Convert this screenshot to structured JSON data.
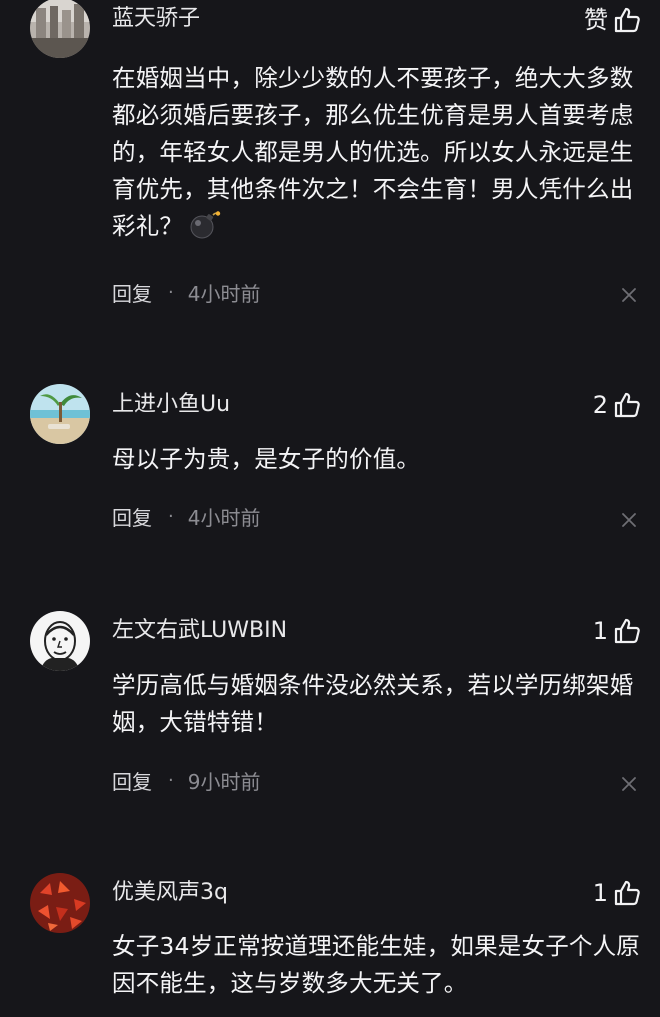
{
  "comments": [
    {
      "username": "蓝天骄子",
      "like_label": "赞",
      "content": "在婚姻当中，除少少数的人不要孩子，绝大大多数都必须婚后要孩子，那么优生优育是男人首要考虑的，年轻女人都是男人的优选。所以女人永远是生育优先，其他条件次之！不会生育！男人凭什么出彩礼？",
      "emoji": "bomb-icon",
      "reply_label": "回复",
      "separator": "·",
      "time": "4小时前"
    },
    {
      "username": "上进小鱼Uu",
      "like_label": "2",
      "content": "母以子为贵，是女子的价值。",
      "reply_label": "回复",
      "separator": "·",
      "time": "4小时前"
    },
    {
      "username": "左文右武LUWBIN",
      "like_label": "1",
      "content": "学历高低与婚姻条件没必然关系，若以学历绑架婚姻，大错特错！",
      "reply_label": "回复",
      "separator": "·",
      "time": "9小时前"
    },
    {
      "username": "优美风声3q",
      "like_label": "1",
      "content": "女子34岁正常按道理还能生娃，如果是女子个人原因不能生，这与岁数多大无关了。"
    }
  ],
  "icons": {
    "like": "thumbs-up-icon",
    "close": "close-icon",
    "emoji": "bomb-icon"
  },
  "colors": {
    "background": "#16161a",
    "text": "#f4f4f6",
    "muted": "#8c8c92"
  }
}
